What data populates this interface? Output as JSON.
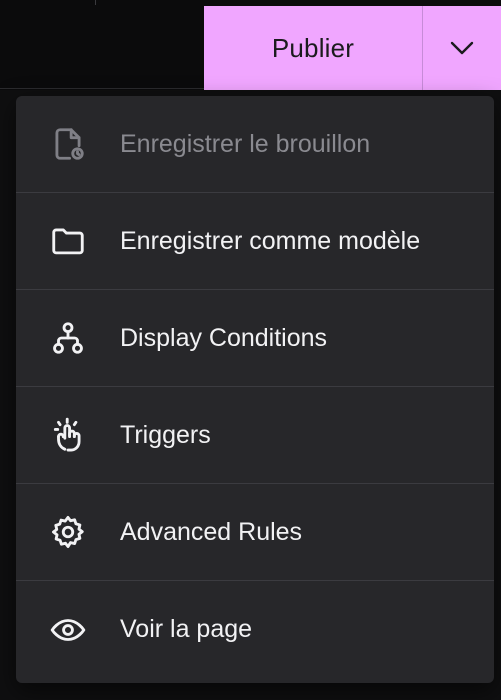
{
  "header": {
    "publish_label": "Publier"
  },
  "menu": {
    "items": [
      {
        "label": "Enregistrer le brouillon",
        "icon": "file-clock-icon",
        "disabled": true
      },
      {
        "label": "Enregistrer comme modèle",
        "icon": "folder-icon",
        "disabled": false
      },
      {
        "label": "Display Conditions",
        "icon": "hierarchy-icon",
        "disabled": false
      },
      {
        "label": "Triggers",
        "icon": "hand-click-icon",
        "disabled": false
      },
      {
        "label": "Advanced Rules",
        "icon": "gear-icon",
        "disabled": false
      },
      {
        "label": "Voir la page",
        "icon": "eye-icon",
        "disabled": false
      }
    ]
  },
  "colors": {
    "accent": "#f0a6ff",
    "menu_background": "#27272a",
    "disabled_text": "#8a8a90"
  }
}
